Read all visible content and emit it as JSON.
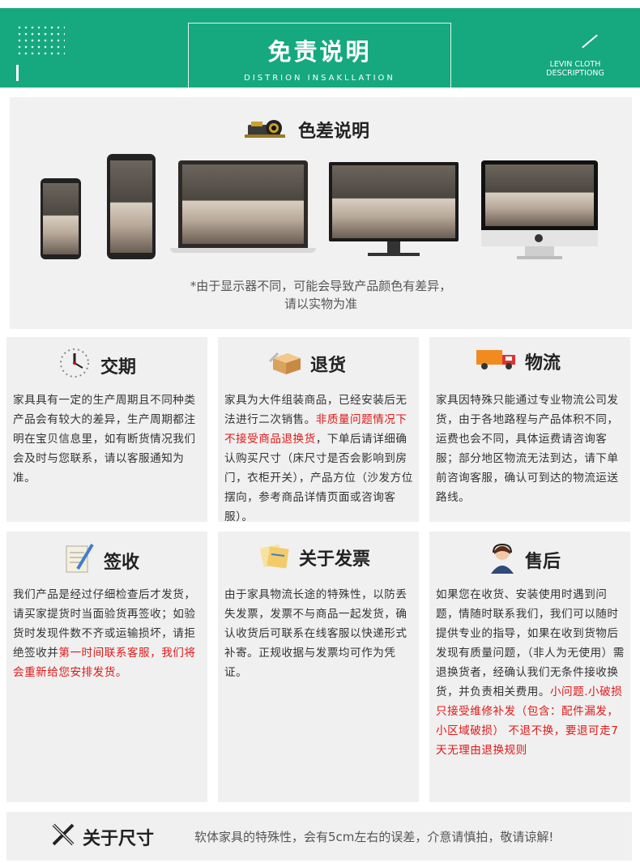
{
  "header": {
    "title": "免责说明",
    "subtitle": "DISTRION INSAKLLATION",
    "right_line1": "LEVIN CLOTH",
    "right_line2": "DESCRIPTIONG"
  },
  "color_diff": {
    "title": "色差说明",
    "note_line1": "*由于显示器不同，可能会导致产品颜色有差异，",
    "note_line2": "请以实物为准"
  },
  "cards": {
    "delivery": {
      "title": "交期",
      "text": "家具具有一定的生产周期且不同种类产品会有较大的差异，生产周期都注明在宝贝信息里，如有断货情况我们会及时与您联系，请以客服通知为准。"
    },
    "returns": {
      "title": "退货",
      "text_a": "家具为大件组装商品，已经安装后无法进行二次销售。",
      "text_red": "非质量问题情况下不接受商品退换货",
      "text_b": "，下单后请详细确认购买尺寸（床尺寸是否会影响到房门，衣柜开关），产品方位（沙发方位摆向，参考商品详情页面或咨询客服）。"
    },
    "logistics": {
      "title": "物流",
      "text": "家具因特殊只能通过专业物流公司发货，由于各地路程与产品体积不同，运费也会不同，具体运费请咨询客服；部分地区物流无法到达，请下单前咨询客服，确认可到达的物流运送路线。"
    },
    "sign": {
      "title": "签收",
      "text_a": "我们产品是经过仔细检查后才发货，请买家提货时当面验货再签收；如验货时发现件数不齐或运输损坏，请拒绝签收并",
      "text_red": "第一时间联系客服，我们将会重新给您安排发货。"
    },
    "invoice": {
      "title": "关于发票",
      "text": "由于家具物流长途的特殊性，以防丢失发票，发票不与商品一起发货，确认收货后可联系在线客服以快递形式补寄。正规收据与发票均可作为凭证。"
    },
    "aftersale": {
      "title": "售后",
      "text_a": "如果您在收货、安装使用时遇到问题，情随时联系我们，我们可以随时提供专业的指导，如果在收到货物后发现有质量问题，（非人为无使用）需退换货者，经确认我们无条件接收换货，并负责相关费用。",
      "text_red": "小问题.小破损只接受维修补发（包含：配件漏发，小区域破损） 不退不换，要退可走7天无理由退换规则"
    }
  },
  "size": {
    "title": "关于尺寸",
    "text": "软体家具的特殊性，会有5cm左右的误差，介意请慎拍，敬请谅解!"
  },
  "colors": {
    "brand_green": "#16a87f",
    "card_bg": "#f0f0f0",
    "highlight_red": "#e01818"
  }
}
